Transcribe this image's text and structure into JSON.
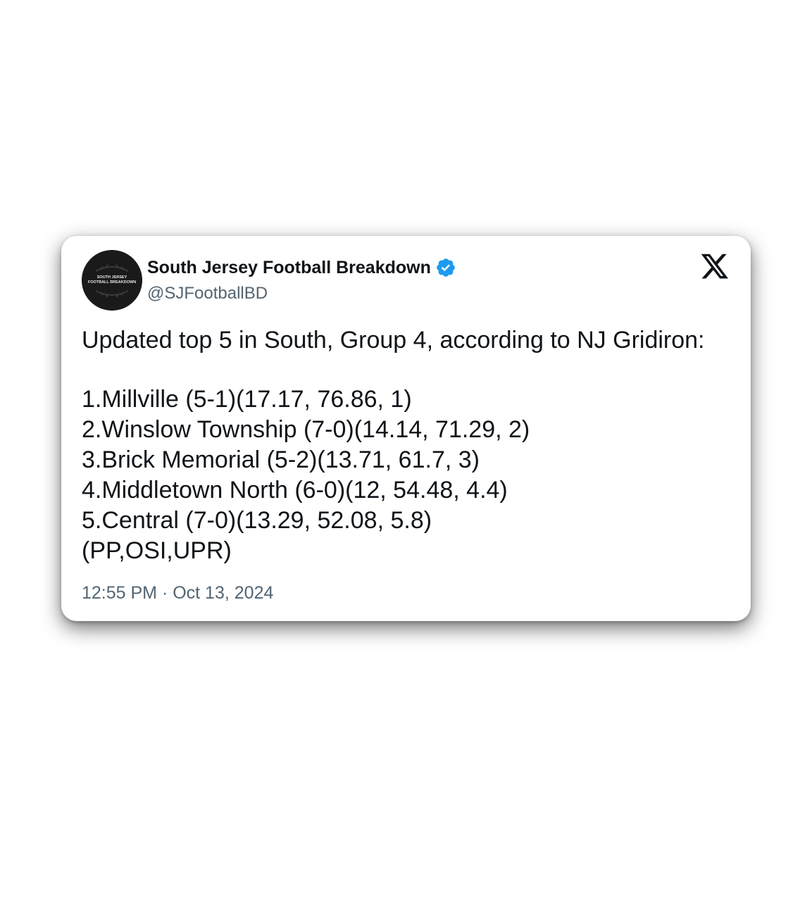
{
  "tweet": {
    "author": {
      "display_name": "South Jersey Football Breakdown",
      "handle": "@SJFootballBD",
      "verified": true,
      "avatar_text_line1": "SOUTH JERSEY",
      "avatar_text_line2": "FOOTBALL BREAKDOWN"
    },
    "text_intro": "Updated top 5 in South, Group 4, according to NJ Gridiron:",
    "rankings": [
      "1.Millville (5-1)(17.17, 76.86, 1)",
      "2.Winslow Township (7-0)(14.14, 71.29, 2)",
      "3.Brick Memorial (5-2)(13.71, 61.7, 3)",
      "4.Middletown North (6-0)(12, 54.48, 4.4)",
      "5.Central (7-0)(13.29, 52.08, 5.8)"
    ],
    "legend": "(PP,OSI,UPR)",
    "timestamp": "12:55 PM · Oct 13, 2024",
    "platform_icon": "x-logo-icon"
  },
  "colors": {
    "verified_badge": "#1d9bf0",
    "text_primary": "#0f1419",
    "text_secondary": "#536471",
    "card_background": "#ffffff",
    "avatar_background": "#1a1a1a"
  }
}
